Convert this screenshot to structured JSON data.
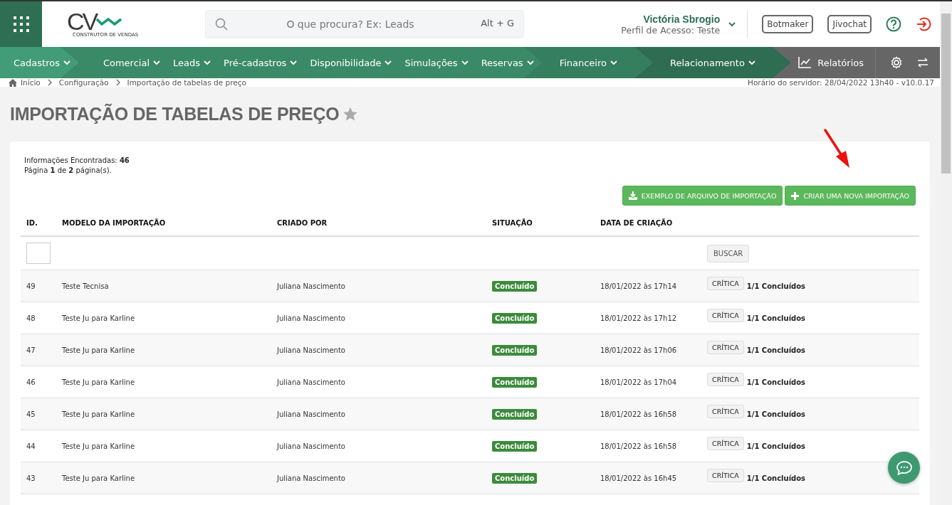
{
  "header": {
    "logo": {
      "mark": "CV",
      "tagline": "CONSTRUTOR DE VENDAS"
    },
    "search": {
      "placeholder": "O que procura? Ex: Leads",
      "shortcut": "Alt + G"
    },
    "user": {
      "name": "Victória Sbrogio",
      "profile": "Perfil de Acesso: Teste"
    },
    "buttons": [
      "Botmaker",
      "Jivochat"
    ]
  },
  "nav": {
    "groups": [
      {
        "color": "#419c77",
        "items": [
          "Cadastros"
        ]
      },
      {
        "color": "#3a8a67",
        "items": [
          "Comercial",
          "Leads",
          "Pré-cadastros",
          "Disponibilidade",
          "Simulações",
          "Reservas"
        ]
      },
      {
        "color": "#357f5f",
        "items": [
          "Financeiro"
        ]
      },
      {
        "color": "#2f6d52",
        "items": [
          "Relacionamento"
        ]
      }
    ],
    "reports": "Relatórios"
  },
  "breadcrumb": {
    "items": [
      "Início",
      "Configuração",
      "Importação de tabelas de preço"
    ],
    "server_time": "Horário do servidor: 28/04/2022 13h40 - v10.0.17"
  },
  "page": {
    "title": "IMPORTAÇÃO DE TABELAS DE PREÇO",
    "favorite": false
  },
  "summary": [
    "Informações Encontradas: **46**",
    "Página **1** de **2** página(s)."
  ],
  "actions": [
    {
      "kind": "download",
      "label": "EXEMPLO DE ARQUIVO DE IMPORTAÇÃO"
    },
    {
      "kind": "add",
      "label": "CRIAR UMA NOVA IMPORTAÇÃO"
    }
  ],
  "table": {
    "columns": [
      "ID.",
      "MODELO DA IMPORTAÇÃO",
      "CRIADO POR",
      "SITUAÇÃO",
      "DATA DE CRIAÇÃO"
    ],
    "search_button": "BUSCAR",
    "rows": [
      {
        "id": "49",
        "model": "Teste Tecnisa",
        "author": "Juliana Nascimento",
        "status": "Concluído",
        "date": "18/01/2022 às 17h14",
        "button": "CRÍTICA",
        "progress": "1/1 Concluídos"
      },
      {
        "id": "48",
        "model": "Teste Ju para Karline",
        "author": "Juliana Nascimento",
        "status": "Concluído",
        "date": "18/01/2022 às 17h12",
        "button": "CRÍTICA",
        "progress": "1/1 Concluídos"
      },
      {
        "id": "47",
        "model": "Teste Ju para Karline",
        "author": "Juliana Nascimento",
        "status": "Concluído",
        "date": "18/01/2022 às 17h06",
        "button": "CRÍTICA",
        "progress": "1/1 Concluídos"
      },
      {
        "id": "46",
        "model": "Teste Ju para Karline",
        "author": "Juliana Nascimento",
        "status": "Concluído",
        "date": "18/01/2022 às 17h04",
        "button": "CRÍTICA",
        "progress": "1/1 Concluídos"
      },
      {
        "id": "45",
        "model": "Teste Ju para Karline",
        "author": "Juliana Nascimento",
        "status": "Concluído",
        "date": "18/01/2022 às 16h58",
        "button": "CRÍTICA",
        "progress": "1/1 Concluídos"
      },
      {
        "id": "44",
        "model": "Teste Ju para Karline",
        "author": "Juliana Nascimento",
        "status": "Concluído",
        "date": "18/01/2022 às 16h58",
        "button": "CRÍTICA",
        "progress": "1/1 Concluídos"
      },
      {
        "id": "43",
        "model": "Teste Ju para Karline",
        "author": "Juliana Nascimento",
        "status": "Concluído",
        "date": "18/01/2022 às 16h45",
        "button": "CRÍTICA",
        "progress": "1/1 Concluídos"
      }
    ]
  }
}
